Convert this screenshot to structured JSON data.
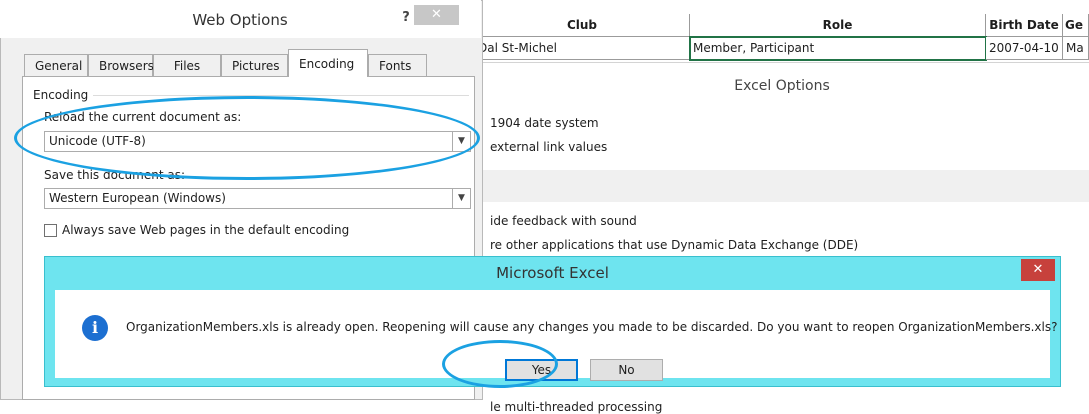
{
  "sheet": {
    "headers": {
      "club": "Club",
      "role": "Role",
      "birth_date": "Birth Date",
      "partial": "Ge"
    },
    "row1": {
      "club": "Dal St-Michel",
      "role": "Member, Participant",
      "birth_date": "2007-04-10",
      "partial": "Ma"
    }
  },
  "excel_options": {
    "title": "Excel Options",
    "lines": {
      "date_system": "1904 date system",
      "external_links": "external link values",
      "feedback_sound": "ide feedback with sound",
      "dde": "re other applications that use Dynamic Data Exchange (DDE)",
      "multithread": "le multi-threaded processing"
    }
  },
  "web_options": {
    "title": "Web Options",
    "help_label": "?",
    "close_label": "✕",
    "tabs": [
      "General",
      "Browsers",
      "Files",
      "Pictures",
      "Encoding",
      "Fonts"
    ],
    "active_tab": "Encoding",
    "group_label": "Encoding",
    "reload_label": "Reload the current document as:",
    "reload_value": "Unicode (UTF-8)",
    "save_label": "Save this document as:",
    "save_value": "Western European (Windows)",
    "checkbox_label": "Always save Web pages in the default encoding",
    "checkbox_checked": false
  },
  "message_box": {
    "title": "Microsoft Excel",
    "close_label": "✕",
    "icon": "info-icon",
    "icon_glyph": "i",
    "message": "OrganizationMembers.xls is already open. Reopening will cause any changes you made to be discarded. Do you want to reopen OrganizationMembers.xls?",
    "yes_label": "Yes",
    "no_label": "No"
  },
  "colors": {
    "message_frame": "#6ee4ef",
    "annotation": "#1ba1e2",
    "selection": "#217346",
    "info_icon": "#1c6fd1",
    "close_red": "#c7413c"
  }
}
